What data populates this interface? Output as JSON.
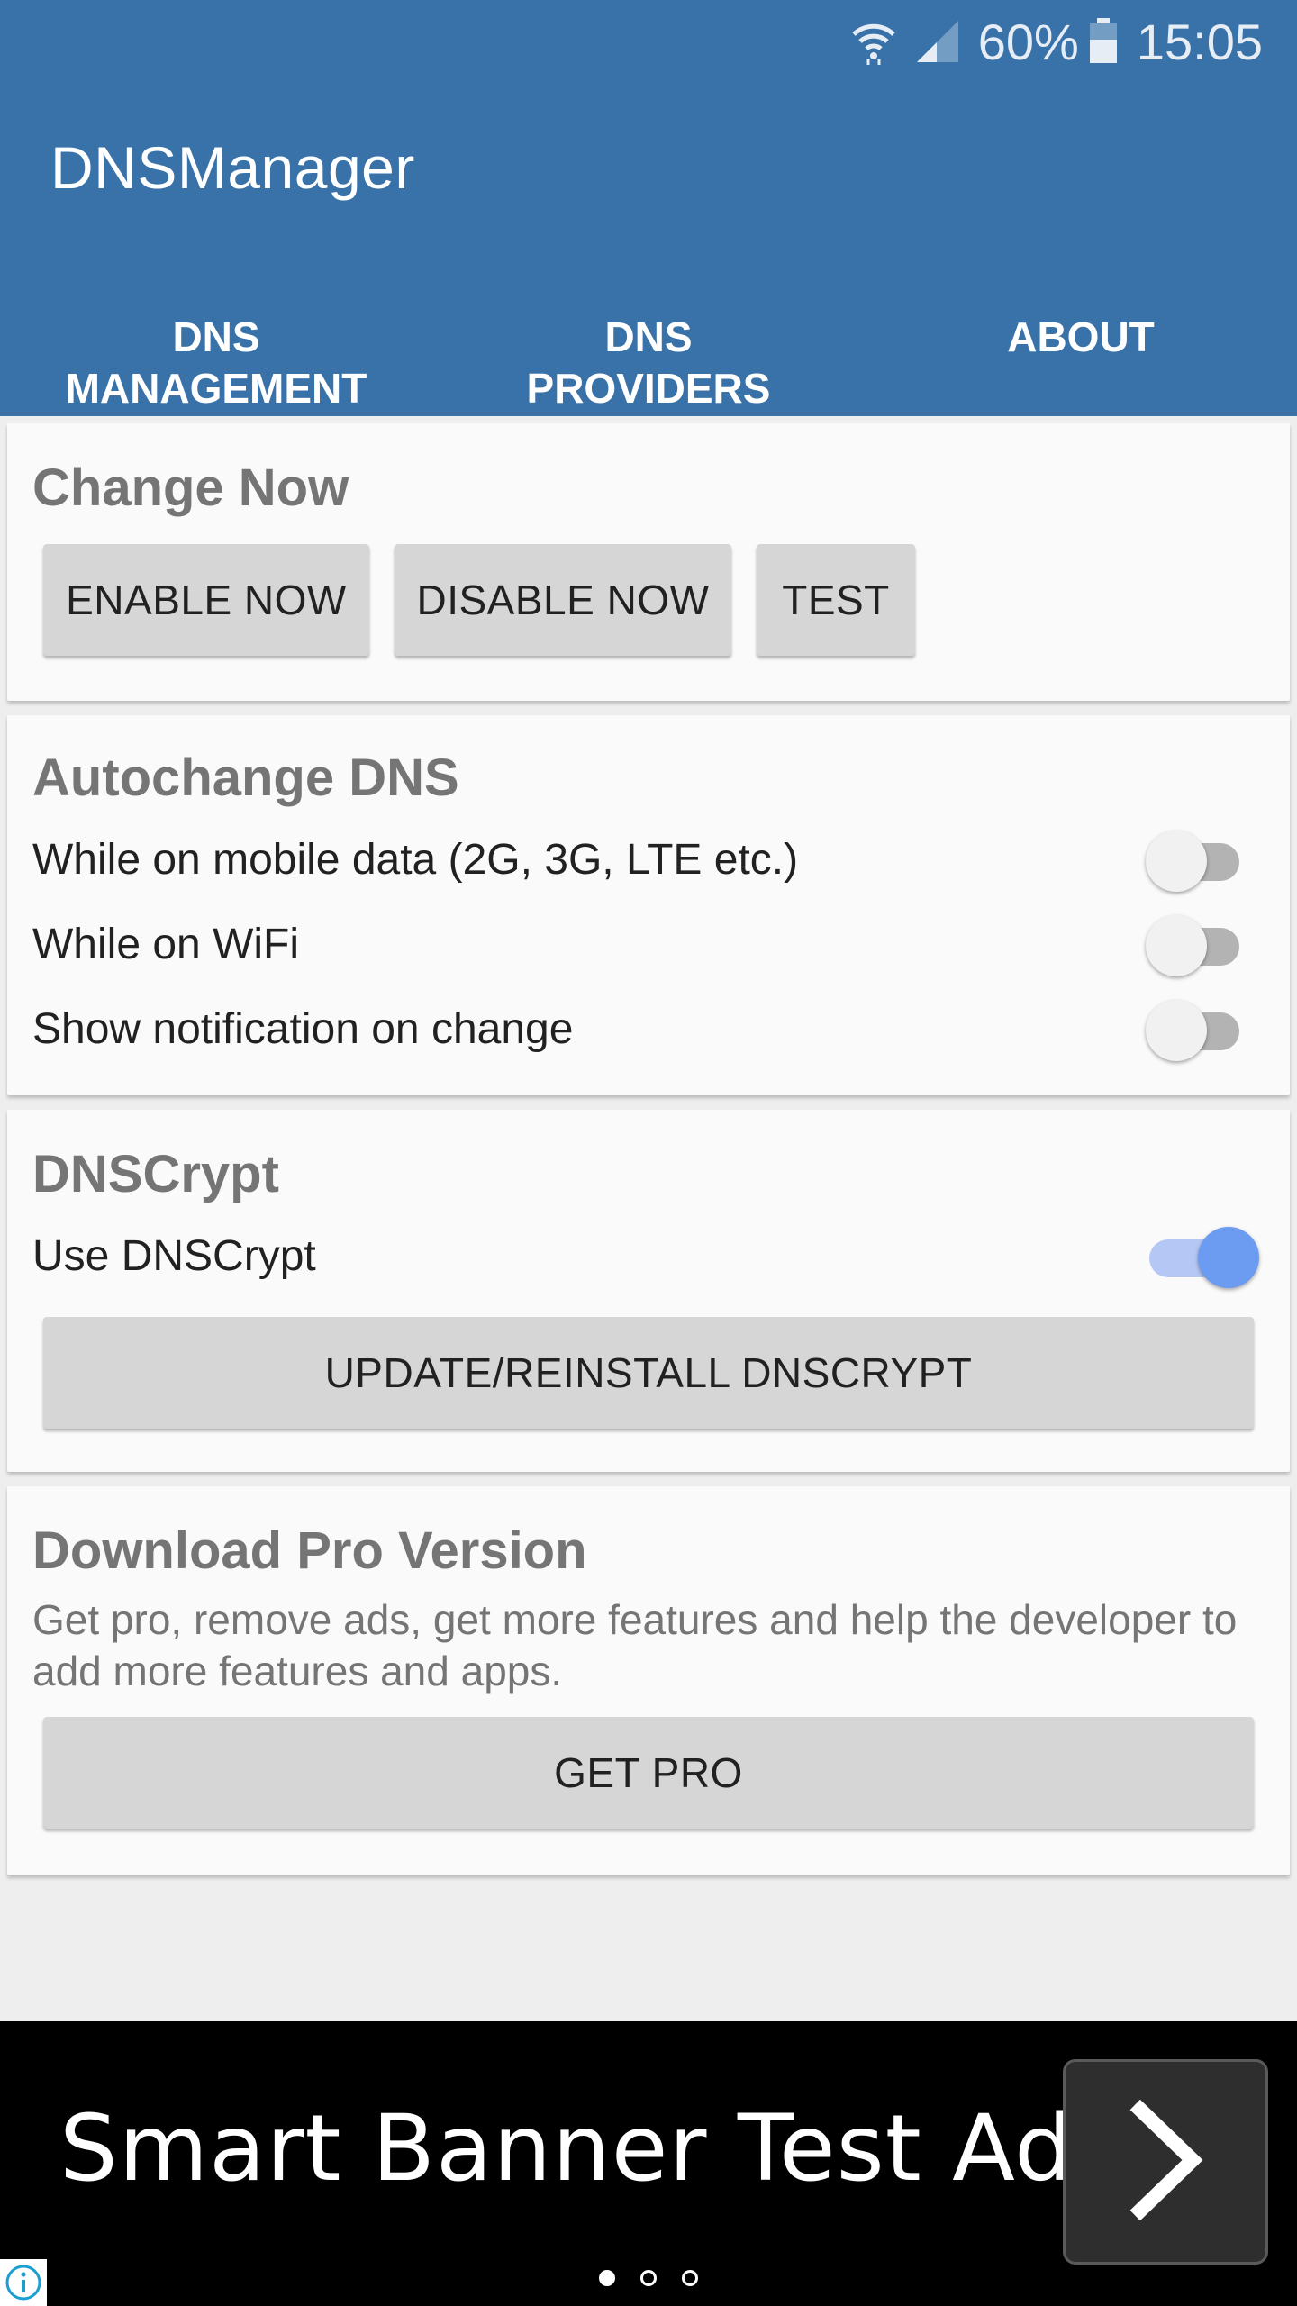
{
  "status_bar": {
    "wifi_icon": "wifi-icon",
    "signal_icon": "cell-signal-icon",
    "battery_percent": "60%",
    "battery_icon": "battery-icon",
    "time": "15:05"
  },
  "app_bar": {
    "title": "DNSManager"
  },
  "tabs": [
    {
      "label": "DNS\nMANAGEMENT"
    },
    {
      "label": "DNS\nPROVIDERS"
    },
    {
      "label": "ABOUT"
    }
  ],
  "change_now": {
    "title": "Change Now",
    "enable_label": "ENABLE NOW",
    "disable_label": "DISABLE NOW",
    "test_label": "TEST"
  },
  "autochange": {
    "title": "Autochange DNS",
    "rows": [
      {
        "label": "While on mobile data (2G, 3G, LTE etc.)",
        "enabled": false
      },
      {
        "label": "While on WiFi",
        "enabled": false
      },
      {
        "label": "Show notification on change",
        "enabled": false
      }
    ]
  },
  "dnscrypt": {
    "title": "DNSCrypt",
    "use_label": "Use DNSCrypt",
    "use_enabled": true,
    "update_label": "UPDATE/REINSTALL DNSCRYPT"
  },
  "pro": {
    "title": "Download Pro Version",
    "description": "Get pro, remove ads, get more features and help the developer to add more features and apps.",
    "button_label": "GET PRO"
  },
  "ad": {
    "title": "Smart Banner Test Ad",
    "arrow_icon": "chevron-right-icon",
    "info_icon": "info-icon",
    "page_dots": 3,
    "active_dot": 1
  },
  "colors": {
    "primary": "#3872a9",
    "switch_on": "#6c9cf2",
    "card_bg": "#fafafa",
    "ad_bg": "#000000"
  }
}
